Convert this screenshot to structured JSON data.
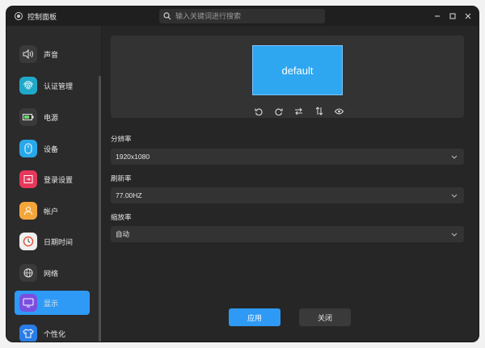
{
  "window": {
    "title": "控制面板",
    "search_placeholder": "输入关键词进行搜索"
  },
  "sidebar": {
    "items": [
      {
        "label": "声音",
        "icon": "speaker-icon",
        "color": "#3a3a3a",
        "active": false
      },
      {
        "label": "认证管理",
        "icon": "fingerprint-icon",
        "color": "#1fa9c9",
        "active": false
      },
      {
        "label": "电源",
        "icon": "battery-icon",
        "color": "#3a3a3a",
        "active": false
      },
      {
        "label": "设备",
        "icon": "mouse-icon",
        "color": "#27a8ea",
        "active": false
      },
      {
        "label": "登录设置",
        "icon": "login-icon",
        "color": "#e7385c",
        "active": false
      },
      {
        "label": "帐户",
        "icon": "account-icon",
        "color": "#f4a63a",
        "active": false
      },
      {
        "label": "日期时间",
        "icon": "clock-icon",
        "color": "#efefef",
        "active": false
      },
      {
        "label": "网络",
        "icon": "globe-icon",
        "color": "#3a3a3a",
        "active": false
      },
      {
        "label": "显示",
        "icon": "display-icon",
        "color": "#7a4fe0",
        "active": true
      },
      {
        "label": "个性化",
        "icon": "shirt-icon",
        "color": "#2a7de6",
        "active": false
      }
    ]
  },
  "display": {
    "monitor_name": "default",
    "tools": [
      {
        "name": "rotate-left-icon"
      },
      {
        "name": "rotate-right-icon"
      },
      {
        "name": "flip-horizontal-icon"
      },
      {
        "name": "flip-vertical-icon"
      },
      {
        "name": "preview-eye-icon"
      }
    ],
    "resolution_label": "分辨率",
    "resolution_value": "1920x1080",
    "refresh_label": "刷新率",
    "refresh_value": "77.00HZ",
    "scale_label": "缩放率",
    "scale_value": "自动",
    "apply_label": "应用",
    "close_label": "关闭"
  },
  "colors": {
    "accent": "#2f9af5",
    "window_bg": "#262626",
    "panel_bg": "#333333"
  }
}
